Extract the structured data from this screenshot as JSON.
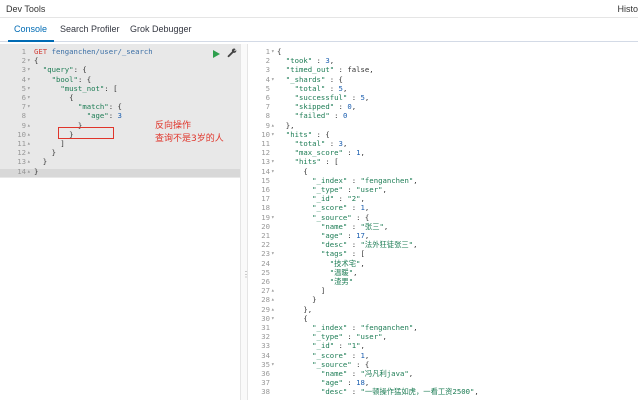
{
  "header": {
    "title": "Dev Tools",
    "right_label": "Histo"
  },
  "tabs": [
    {
      "label": "Console"
    },
    {
      "label": "Search Profiler"
    },
    {
      "label": "Grok Debugger"
    }
  ],
  "annotation": {
    "line1": "反向操作",
    "line2": "查询不是3岁的人"
  },
  "request": {
    "method": "GET",
    "url": "fenganchen/user/_search",
    "lines": [
      {
        "n": "1",
        "f": "",
        "t": ""
      },
      {
        "n": "2",
        "f": "▾",
        "t": "{"
      },
      {
        "n": "3",
        "f": "▾",
        "t": "  \"query\": {"
      },
      {
        "n": "4",
        "f": "▾",
        "t": "    \"bool\": {"
      },
      {
        "n": "5",
        "f": "▾",
        "t": "      \"must_not\": ["
      },
      {
        "n": "6",
        "f": "▾",
        "t": "        {"
      },
      {
        "n": "7",
        "f": "▾",
        "t": "          \"match\": {"
      },
      {
        "n": "8",
        "f": "",
        "t": "            \"age\": 3"
      },
      {
        "n": "9",
        "f": "▴",
        "t": "          }"
      },
      {
        "n": "10",
        "f": "▴",
        "t": "        }"
      },
      {
        "n": "11",
        "f": "▴",
        "t": "      ]"
      },
      {
        "n": "12",
        "f": "▴",
        "t": "    }"
      },
      {
        "n": "13",
        "f": "▴",
        "t": "  }"
      },
      {
        "n": "14",
        "f": "▴",
        "t": "}"
      }
    ]
  },
  "response": {
    "lines": [
      {
        "n": "1",
        "f": "▾",
        "t": "{"
      },
      {
        "n": "2",
        "f": "",
        "t": "  \"took\" : 3,"
      },
      {
        "n": "3",
        "f": "",
        "t": "  \"timed_out\" : false,"
      },
      {
        "n": "4",
        "f": "▾",
        "t": "  \"_shards\" : {"
      },
      {
        "n": "5",
        "f": "",
        "t": "    \"total\" : 5,"
      },
      {
        "n": "6",
        "f": "",
        "t": "    \"successful\" : 5,"
      },
      {
        "n": "7",
        "f": "",
        "t": "    \"skipped\" : 0,"
      },
      {
        "n": "8",
        "f": "",
        "t": "    \"failed\" : 0"
      },
      {
        "n": "9",
        "f": "▴",
        "t": "  },"
      },
      {
        "n": "10",
        "f": "▾",
        "t": "  \"hits\" : {"
      },
      {
        "n": "11",
        "f": "",
        "t": "    \"total\" : 3,"
      },
      {
        "n": "12",
        "f": "",
        "t": "    \"max_score\" : 1,"
      },
      {
        "n": "13",
        "f": "▾",
        "t": "    \"hits\" : ["
      },
      {
        "n": "14",
        "f": "▾",
        "t": "      {"
      },
      {
        "n": "15",
        "f": "",
        "t": "        \"_index\" : \"fenganchen\","
      },
      {
        "n": "16",
        "f": "",
        "t": "        \"_type\" : \"user\","
      },
      {
        "n": "17",
        "f": "",
        "t": "        \"_id\" : \"2\","
      },
      {
        "n": "18",
        "f": "",
        "t": "        \"_score\" : 1,"
      },
      {
        "n": "19",
        "f": "▾",
        "t": "        \"_source\" : {"
      },
      {
        "n": "20",
        "f": "",
        "t": "          \"name\" : \"张三\","
      },
      {
        "n": "21",
        "f": "",
        "t": "          \"age\" : 17,"
      },
      {
        "n": "22",
        "f": "",
        "t": "          \"desc\" : \"法外狂徒张三\","
      },
      {
        "n": "23",
        "f": "▾",
        "t": "          \"tags\" : ["
      },
      {
        "n": "24",
        "f": "",
        "t": "            \"技术宅\","
      },
      {
        "n": "25",
        "f": "",
        "t": "            \"温暖\","
      },
      {
        "n": "26",
        "f": "",
        "t": "            \"渣男\""
      },
      {
        "n": "27",
        "f": "▴",
        "t": "          ]"
      },
      {
        "n": "28",
        "f": "▴",
        "t": "        }"
      },
      {
        "n": "29",
        "f": "▴",
        "t": "      },"
      },
      {
        "n": "30",
        "f": "▾",
        "t": "      {"
      },
      {
        "n": "31",
        "f": "",
        "t": "        \"_index\" : \"fenganchen\","
      },
      {
        "n": "32",
        "f": "",
        "t": "        \"_type\" : \"user\","
      },
      {
        "n": "33",
        "f": "",
        "t": "        \"_id\" : \"1\","
      },
      {
        "n": "34",
        "f": "",
        "t": "        \"_score\" : 1,"
      },
      {
        "n": "35",
        "f": "▾",
        "t": "        \"_source\" : {"
      },
      {
        "n": "36",
        "f": "",
        "t": "          \"name\" : \"冯凡利java\","
      },
      {
        "n": "37",
        "f": "",
        "t": "          \"age\" : 18,"
      },
      {
        "n": "38",
        "f": "",
        "t": "          \"desc\" : \"一顿操作猛如虎，一看工资2500\","
      }
    ]
  }
}
